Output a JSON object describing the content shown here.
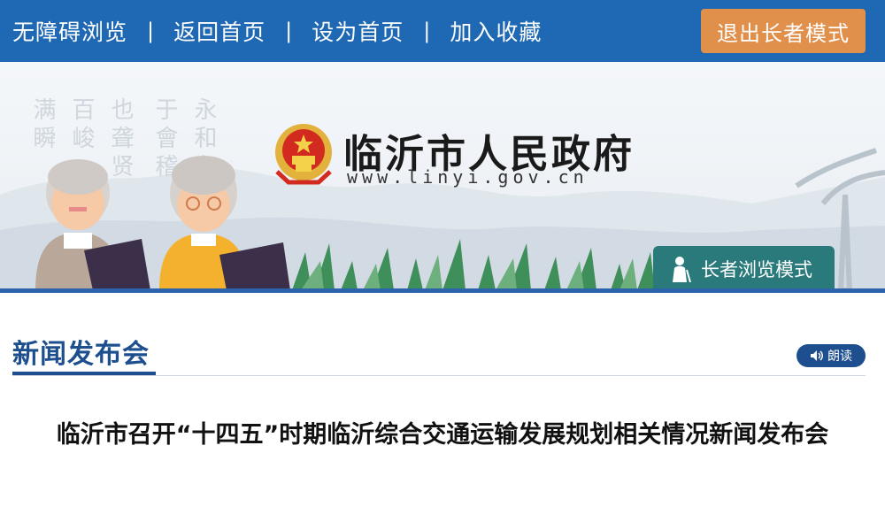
{
  "topbar": {
    "nav": [
      "无障碍浏览",
      "返回首页",
      "设为首页",
      "加入收藏"
    ],
    "separator": "|",
    "exit_label": "退出长者模式"
  },
  "banner": {
    "site_title": "临沂市人民政府",
    "site_url": "www.linyi.gov.cn",
    "elder_mode_label": "长者浏览模式",
    "calligraphy": [
      "满瞬",
      "百峻",
      "也聋贤",
      "于會稽",
      "永和九"
    ]
  },
  "section": {
    "title": "新闻发布会",
    "read_label": "朗读"
  },
  "article": {
    "title": "临沂市召开“十四五”时期临沂综合交通运输发展规划相关情况新闻发布会"
  },
  "colors": {
    "topbar": "#1f68b4",
    "exit_button": "#e0904a",
    "elder_tab": "#2a7a7c",
    "section_accent": "#1d4f8f"
  }
}
